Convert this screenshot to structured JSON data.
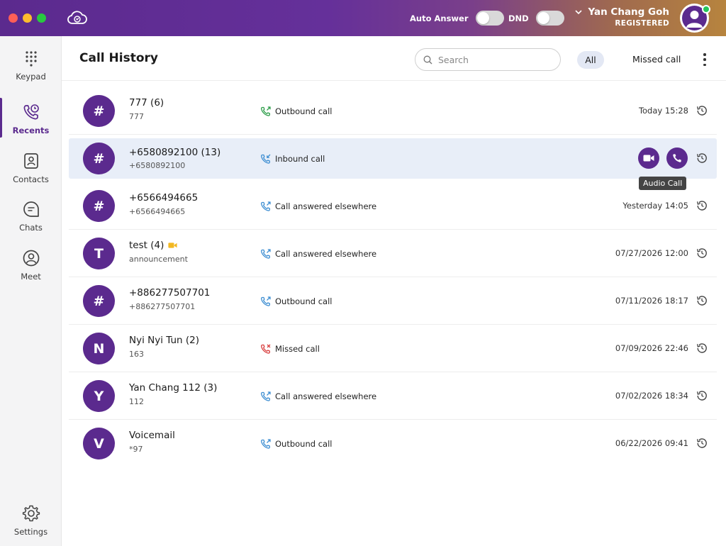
{
  "topbar": {
    "auto_answer_label": "Auto Answer",
    "dnd_label": "DND",
    "user_name": "Yan Chang Goh",
    "user_status": "REGISTERED",
    "presence_color": "#26c65a"
  },
  "sidebar": {
    "items": [
      {
        "label": "Keypad",
        "icon": "keypad-icon"
      },
      {
        "label": "Recents",
        "icon": "recents-icon",
        "active": true
      },
      {
        "label": "Contacts",
        "icon": "contacts-icon"
      },
      {
        "label": "Chats",
        "icon": "chats-icon"
      },
      {
        "label": "Meet",
        "icon": "meet-icon"
      }
    ],
    "settings_label": "Settings"
  },
  "header": {
    "title": "Call History",
    "search_placeholder": "Search",
    "filter_all": "All",
    "filter_missed": "Missed call"
  },
  "calls": [
    {
      "avatar": "#",
      "name": "777 (6)",
      "sub": "777",
      "type": "Outbound call",
      "kind": "outbound",
      "time": "Today 15:28"
    },
    {
      "avatar": "#",
      "name": "+6580892100 (13)",
      "sub": "+6580892100",
      "type": "Inbound call",
      "kind": "inbound",
      "time": ""
    },
    {
      "avatar": "#",
      "name": "+6566494665",
      "sub": "+6566494665",
      "type": "Call answered elsewhere",
      "kind": "elsewhere",
      "time": "Yesterday 14:05"
    },
    {
      "avatar": "T",
      "name": "test (4)",
      "sub": "announcement",
      "type": "Call answered elsewhere",
      "kind": "elsewhere",
      "time": "07/27/2026 12:00",
      "video": true
    },
    {
      "avatar": "#",
      "name": "+886277507701",
      "sub": "+886277507701",
      "type": "Outbound call",
      "kind": "outbound-blue",
      "time": "07/11/2026 18:17"
    },
    {
      "avatar": "N",
      "name": "Nyi Nyi Tun (2)",
      "sub": "163",
      "type": "Missed call",
      "kind": "missed",
      "time": "07/09/2026 22:46"
    },
    {
      "avatar": "Y",
      "name": "Yan Chang 112 (3)",
      "sub": "112",
      "type": "Call answered elsewhere",
      "kind": "elsewhere",
      "time": "07/02/2026 18:34"
    },
    {
      "avatar": "V",
      "name": "Voicemail",
      "sub": "*97",
      "type": "Outbound call",
      "kind": "outbound-blue",
      "time": "06/22/2026 09:41"
    }
  ],
  "tooltip": "Audio Call",
  "colors": {
    "brand": "#5b2a8e",
    "row_highlight": "#e8eef8",
    "outbound_green": "#2e9e4a",
    "call_blue": "#3f8fd2",
    "missed_red": "#d94040",
    "video_yellow": "#f2b822"
  }
}
